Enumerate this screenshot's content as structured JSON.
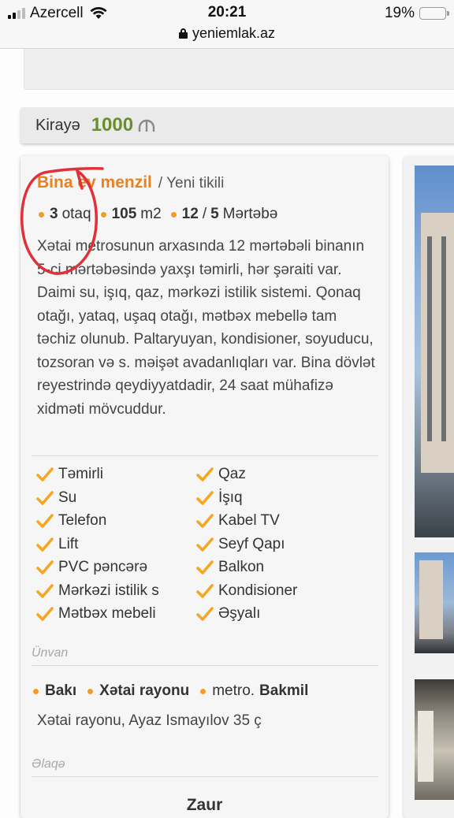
{
  "status_bar": {
    "carrier": "Azercell",
    "time": "20:21",
    "battery": "19%",
    "battery_level": 0.19,
    "url": "yeniemlak.az"
  },
  "listing": {
    "price_label": "Kirayə",
    "price_value": "1000",
    "currency_icon": "manat-icon",
    "title": "Bina ev menzil",
    "subtitle": "/ Yeni tikili",
    "rooms_num": "3",
    "rooms_label": "otaq",
    "area_num": "105",
    "area_unit": "m2",
    "floor_num": "12",
    "floor_sep": "/",
    "floor_total": "5",
    "floor_label": "Mərtəbə",
    "description": "Xətai metrosunun arxasında 12 mərtəbəli binanın 5-ci mərtəbəsində yaxşı təmirli, hər şəraiti var. Daimi su, işıq, qaz, mərkəzi istilik sistemi. Qonaq otağı, yataq, uşaq otağı, mətbəx mebellə tam təchiz olunub. Paltaryuyan, kondisioner, soyuducu, tozsoran və s. məişət avadanlıqları var. Bina dövlət reyestrində qeydiyyatdadir, 24 saat mühafizə xidməti mövcuddur.",
    "features": [
      "Təmirli",
      "Qaz",
      "Su",
      "İşıq",
      "Telefon",
      "Kabel TV",
      "Lift",
      "Seyf Qapı",
      "PVC pəncərə",
      "Balkon",
      "Mərkəzi istilik s",
      "Kondisioner",
      "Mətbəx mebeli",
      "Əşyalı"
    ],
    "address_section": "Ünvan",
    "city": "Bakı",
    "district": "Xətai rayonu",
    "metro_prefix": "metro.",
    "metro": "Bakmil",
    "address_full": "Xətai rayonu, Ayaz Ismayılov 35 ç",
    "contact_section": "Əlaqə",
    "contact_name": "Zaur"
  },
  "colors": {
    "accent": "#e8821e",
    "price": "#6a8f2a",
    "bullet": "#f39c26",
    "annotation": "#e0303a"
  }
}
